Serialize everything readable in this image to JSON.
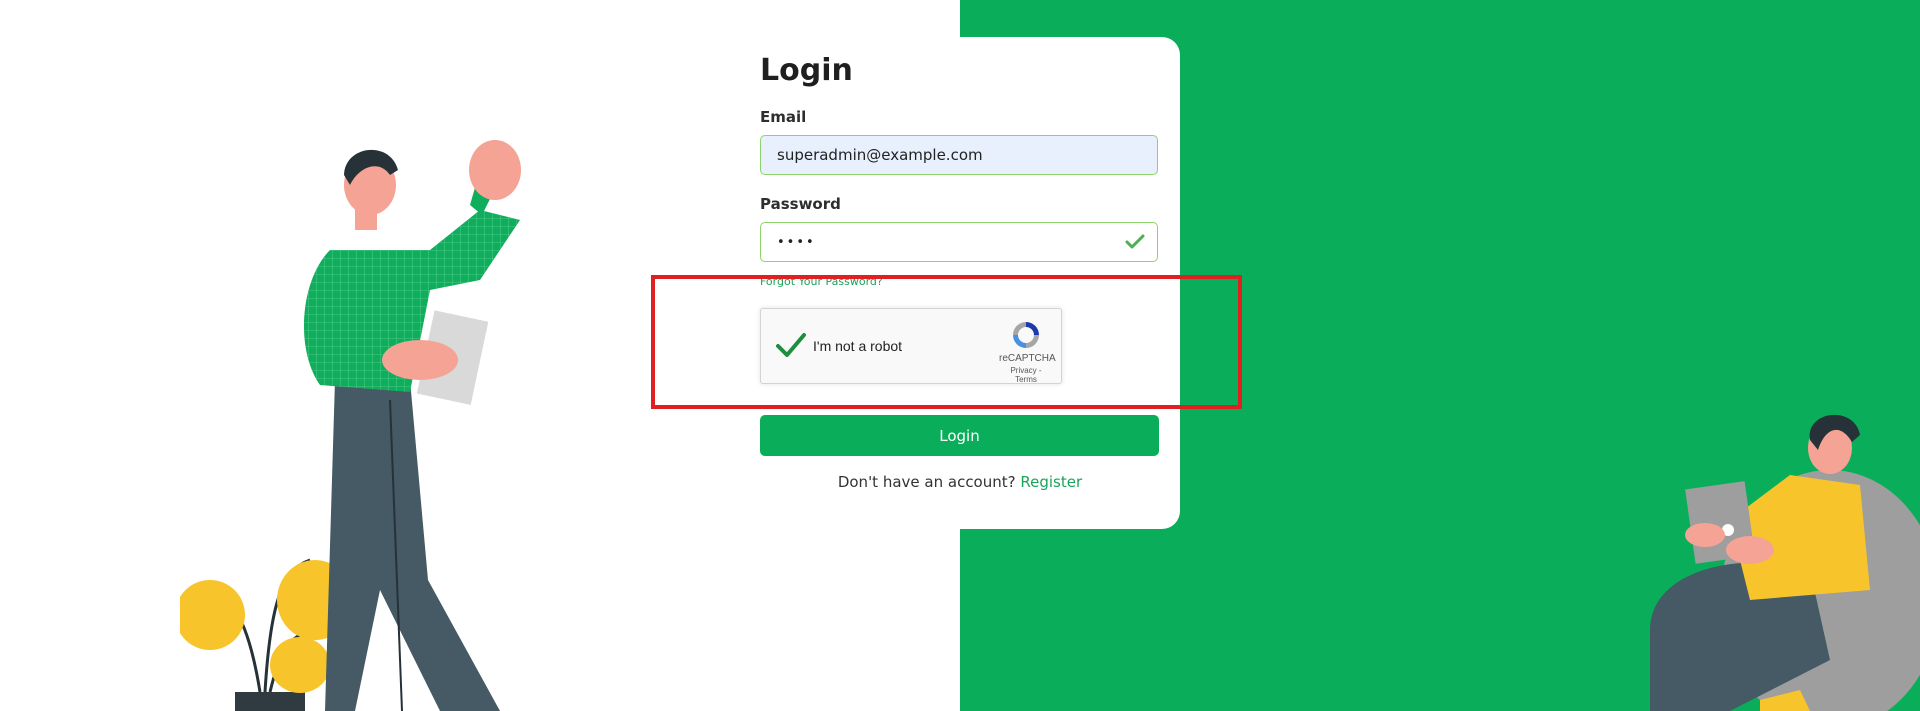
{
  "login": {
    "title": "Login",
    "email_label": "Email",
    "email_value": "superadmin@example.com",
    "password_label": "Password",
    "password_value": "••••",
    "forgot_link": "Forgot Your Password?",
    "login_button": "Login",
    "no_account_text": "Don't have an account?",
    "register_link": "Register"
  },
  "recaptcha": {
    "label": "I'm not a robot",
    "brand": "reCAPTCHA",
    "privacy": "Privacy",
    "separator": " - ",
    "terms": "Terms",
    "checked": true
  },
  "colors": {
    "brand_green": "#0aae5a",
    "highlight_red": "#e02020",
    "input_border": "#8fd46a",
    "plant_yellow": "#f7c52b",
    "pants_gray": "#455a64"
  },
  "icons": {
    "password_valid": "check-icon",
    "recaptcha_check": "check-icon",
    "recaptcha_logo": "recaptcha-logo-icon"
  }
}
